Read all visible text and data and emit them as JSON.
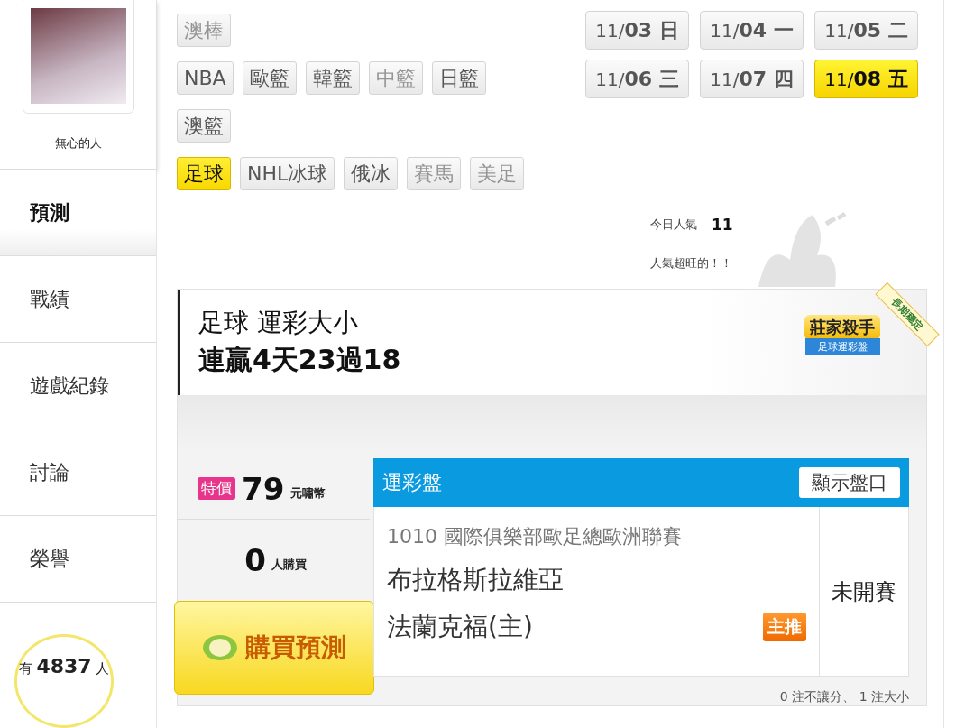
{
  "profile": {
    "name": "無心的人"
  },
  "nav": [
    {
      "label": "預測",
      "selected": true
    },
    {
      "label": "戰績",
      "selected": false
    },
    {
      "label": "遊戲紀錄",
      "selected": false
    },
    {
      "label": "討論",
      "selected": false
    },
    {
      "label": "榮譽",
      "selected": false
    }
  ],
  "visitors": {
    "prefix": "有",
    "count": "4837",
    "suffix": "人"
  },
  "sport_rows": [
    [
      {
        "label": "澳棒",
        "selected": false,
        "disabled": true
      }
    ],
    [
      {
        "label": "NBA",
        "selected": false,
        "disabled": false
      },
      {
        "label": "歐籃",
        "selected": false,
        "disabled": false
      },
      {
        "label": "韓籃",
        "selected": false,
        "disabled": false
      },
      {
        "label": "中籃",
        "selected": false,
        "disabled": true
      },
      {
        "label": "日籃",
        "selected": false,
        "disabled": false
      }
    ],
    [
      {
        "label": "澳籃",
        "selected": false,
        "disabled": false
      }
    ],
    [
      {
        "label": "足球",
        "selected": true,
        "disabled": false
      },
      {
        "label": "NHL冰球",
        "selected": false,
        "disabled": false
      },
      {
        "label": "俄冰",
        "selected": false,
        "disabled": false
      },
      {
        "label": "賽馬",
        "selected": false,
        "disabled": true
      },
      {
        "label": "美足",
        "selected": false,
        "disabled": true
      }
    ]
  ],
  "dates": [
    {
      "date": "11/",
      "day": "03 日",
      "selected": false
    },
    {
      "date": "11/",
      "day": "04 一",
      "selected": false
    },
    {
      "date": "11/",
      "day": "05 二",
      "selected": false
    },
    {
      "date": "11/",
      "day": "06 三",
      "selected": false
    },
    {
      "date": "11/",
      "day": "07 四",
      "selected": false
    },
    {
      "date": "11/",
      "day": "08 五",
      "selected": true
    }
  ],
  "popularity": {
    "label": "今日人氣",
    "value": "11",
    "note": "人氣超旺的！！"
  },
  "card": {
    "title": "足球 運彩大小",
    "streak": "連贏4天23過18",
    "badge": {
      "title": "莊家殺手",
      "subtitle": "足球運彩盤",
      "ribbon": "長期穩定"
    }
  },
  "offer": {
    "tag": "特價",
    "price": "79",
    "unit": "元嘯幣",
    "buyers": "0",
    "buyers_unit": "人購買",
    "buy_button": "購買預測"
  },
  "table": {
    "title": "運彩盤",
    "toggle": "顯示盤口",
    "code": "1010",
    "league": "國際俱樂部歐足總歐洲聯賽",
    "team_away": "布拉格斯拉維亞",
    "team_home": "法蘭克福(主)",
    "pick_tag": "主推",
    "status": "未開賽"
  },
  "footnote": "0 注不讓分、 1 注大小"
}
